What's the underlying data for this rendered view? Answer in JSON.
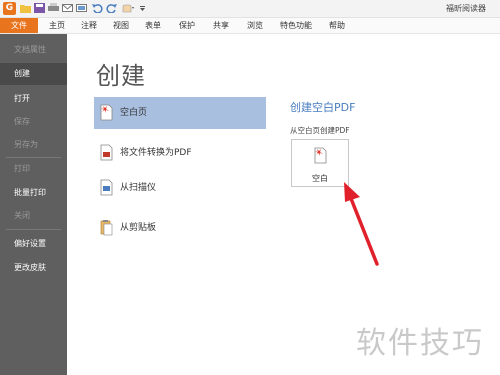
{
  "app": {
    "logo_letter": "G",
    "title": "福昕阅读器"
  },
  "menu": [
    {
      "label": "文件",
      "active": true
    },
    {
      "label": "主页"
    },
    {
      "label": "注释"
    },
    {
      "label": "视图"
    },
    {
      "label": "表单"
    },
    {
      "label": "保护"
    },
    {
      "label": "共享"
    },
    {
      "label": "浏览"
    },
    {
      "label": "特色功能"
    },
    {
      "label": "帮助"
    }
  ],
  "sidebar": {
    "items": [
      {
        "label": "文档属性",
        "enabled": false
      },
      {
        "label": "创建",
        "enabled": true,
        "active": true
      },
      {
        "label": "打开",
        "enabled": true
      },
      {
        "label": "保存",
        "enabled": false
      },
      {
        "label": "另存为",
        "enabled": false
      },
      {
        "label": "打印",
        "enabled": false
      },
      {
        "label": "批量打印",
        "enabled": true
      },
      {
        "label": "关闭",
        "enabled": false
      },
      {
        "label": "偏好设置",
        "enabled": true
      },
      {
        "label": "更改皮肤",
        "enabled": true
      }
    ]
  },
  "main": {
    "heading": "创建",
    "options": [
      {
        "label": "空白页",
        "icon": "blank-page-icon",
        "selected": true
      },
      {
        "label": "将文件转换为PDF",
        "icon": "convert-to-pdf-icon"
      },
      {
        "label": "从扫描仪",
        "icon": "scanner-icon"
      },
      {
        "label": "从剪贴板",
        "icon": "clipboard-icon"
      }
    ]
  },
  "panel": {
    "title": "创建空白PDF",
    "subtitle": "从空白页创建PDF",
    "blank_button_label": "空白"
  },
  "watermark": "软件技巧",
  "colors": {
    "accent": "#e8741e",
    "sidebar": "#5f5f5f",
    "selected": "#a9bfe0",
    "link": "#4a7dbf",
    "arrow": "#e0202a"
  }
}
